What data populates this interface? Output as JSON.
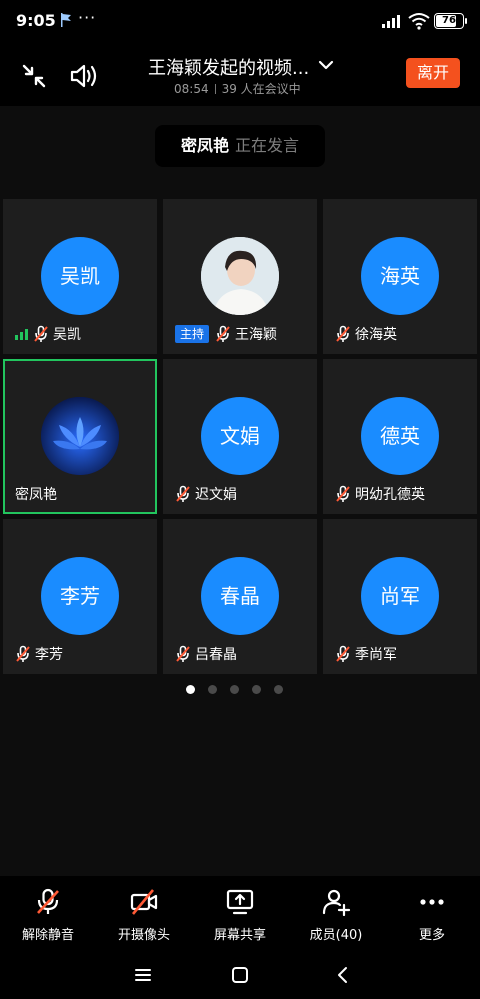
{
  "status_bar": {
    "time": "9:05",
    "dots": "···",
    "battery": "76"
  },
  "header": {
    "title": "王海颖发起的视频...",
    "duration": "08:54",
    "attendance": "39 人在会议中",
    "leave_label": "离开"
  },
  "speaker": {
    "name": "密凤艳",
    "status": "正在发言"
  },
  "tiles": [
    {
      "avatar_text": "吴凯",
      "name": "吴凯"
    },
    {
      "avatar_text": "",
      "name": "王海颖",
      "badge": "主持"
    },
    {
      "avatar_text": "海英",
      "name": "徐海英"
    },
    {
      "avatar_text": "",
      "name": "密凤艳"
    },
    {
      "avatar_text": "文娟",
      "name": "迟文娟"
    },
    {
      "avatar_text": "德英",
      "name": "明幼孔德英"
    },
    {
      "avatar_text": "李芳",
      "name": "李芳"
    },
    {
      "avatar_text": "春晶",
      "name": "吕春晶"
    },
    {
      "avatar_text": "尚军",
      "name": "季尚军"
    }
  ],
  "toolbar": {
    "unmute": "解除静音",
    "camera": "开摄像头",
    "share": "屏幕共享",
    "members": "成员(40)",
    "more": "更多"
  },
  "colors": {
    "accent": "#1a8cff",
    "leave": "#f4511e",
    "active_border": "#22c55e",
    "mute_slash": "#ff5a36"
  }
}
